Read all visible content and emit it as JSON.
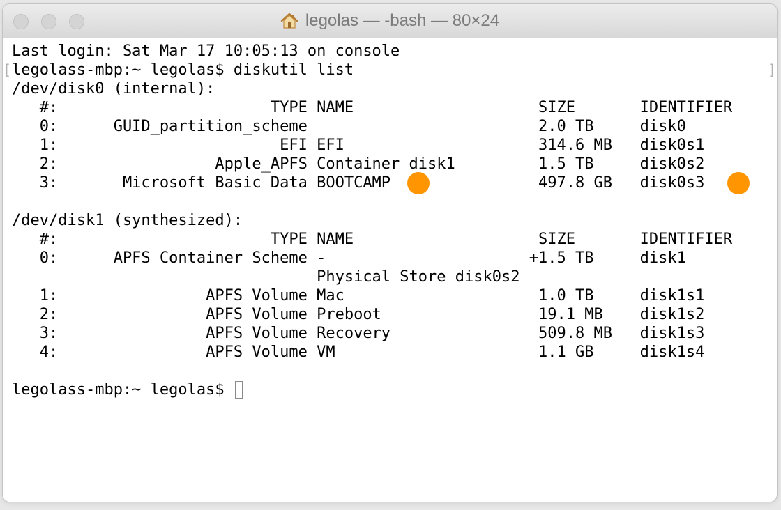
{
  "window": {
    "title": "legolas — -bash — 80×24"
  },
  "terminal": {
    "lines": [
      "Last login: Sat Mar 17 10:05:13 on console",
      "legolass-mbp:~ legolas$ diskutil list",
      "/dev/disk0 (internal):",
      "   #:                       TYPE NAME                    SIZE       IDENTIFIER",
      "   0:      GUID_partition_scheme                         2.0 TB     disk0",
      "   1:                        EFI EFI                     314.6 MB   disk0s1",
      "   2:                 Apple_APFS Container disk1         1.5 TB     disk0s2",
      "   3:       Microsoft Basic Data BOOTCAMP                497.8 GB   disk0s3",
      "",
      "/dev/disk1 (synthesized):",
      "   #:                       TYPE NAME                    SIZE       IDENTIFIER",
      "   0:      APFS Container Scheme -                      +1.5 TB     disk1",
      "                                 Physical Store disk0s2",
      "   1:                APFS Volume Mac                     1.0 TB     disk1s1",
      "   2:                APFS Volume Preboot                 19.1 MB    disk1s2",
      "   3:                APFS Volume Recovery                509.8 MB   disk1s3",
      "   4:                APFS Volume VM                      1.1 GB     disk1s4",
      "",
      "legolass-mbp:~ legolas$ "
    ]
  },
  "highlights": {
    "color": "#ff9500"
  },
  "brackets": {
    "left": "[",
    "right": "]"
  }
}
